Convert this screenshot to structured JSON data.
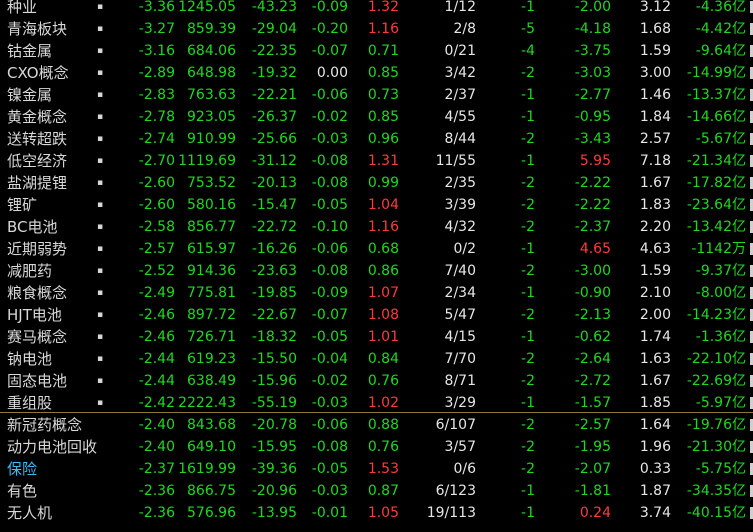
{
  "rows": [
    {
      "name": "种业",
      "v": [
        "-3.36",
        "1245.05",
        "-43.23",
        "-0.09",
        "1.32",
        "1/12",
        "-1",
        "-2.00",
        "3.12",
        "-4.36亿"
      ]
    },
    {
      "name": "青海板块",
      "v": [
        "-3.27",
        "859.39",
        "-29.04",
        "-0.20",
        "1.16",
        "2/8",
        "-5",
        "-4.18",
        "1.68",
        "-4.42亿"
      ]
    },
    {
      "name": "钴金属",
      "v": [
        "-3.16",
        "684.06",
        "-22.35",
        "-0.07",
        "0.71",
        "0/21",
        "-4",
        "-3.75",
        "1.59",
        "-9.64亿"
      ]
    },
    {
      "name": "CXO概念",
      "v": [
        "-2.89",
        "648.98",
        "-19.32",
        "0.00",
        "0.85",
        "3/42",
        "-2",
        "-3.03",
        "3.00",
        "-14.99亿"
      ]
    },
    {
      "name": "镍金属",
      "v": [
        "-2.83",
        "763.63",
        "-22.21",
        "-0.06",
        "0.73",
        "2/37",
        "-1",
        "-2.77",
        "1.46",
        "-13.37亿"
      ]
    },
    {
      "name": "黄金概念",
      "v": [
        "-2.78",
        "923.05",
        "-26.37",
        "-0.02",
        "0.85",
        "4/55",
        "-1",
        "-0.95",
        "1.84",
        "-14.66亿"
      ]
    },
    {
      "name": "送转超跌",
      "v": [
        "-2.74",
        "910.99",
        "-25.66",
        "-0.03",
        "0.96",
        "8/44",
        "-2",
        "-3.43",
        "2.57",
        "-5.67亿"
      ]
    },
    {
      "name": "低空经济",
      "v": [
        "-2.70",
        "1119.69",
        "-31.12",
        "-0.08",
        "1.31",
        "11/55",
        "-1",
        "5.95",
        "7.18",
        "-21.34亿"
      ]
    },
    {
      "name": "盐湖提锂",
      "v": [
        "-2.60",
        "753.52",
        "-20.13",
        "-0.08",
        "0.99",
        "2/35",
        "-2",
        "-2.22",
        "1.67",
        "-17.82亿"
      ]
    },
    {
      "name": "锂矿",
      "v": [
        "-2.60",
        "580.16",
        "-15.47",
        "-0.05",
        "1.04",
        "3/39",
        "-2",
        "-2.22",
        "1.83",
        "-23.64亿"
      ]
    },
    {
      "name": "BC电池",
      "v": [
        "-2.58",
        "856.77",
        "-22.72",
        "-0.10",
        "1.16",
        "4/32",
        "-2",
        "-2.37",
        "2.20",
        "-13.42亿"
      ]
    },
    {
      "name": "近期弱势",
      "v": [
        "-2.57",
        "615.97",
        "-16.26",
        "-0.06",
        "0.68",
        "0/2",
        "-1",
        "4.65",
        "4.63",
        "-1142万"
      ]
    },
    {
      "name": "减肥药",
      "v": [
        "-2.52",
        "914.36",
        "-23.63",
        "-0.08",
        "0.86",
        "7/40",
        "-2",
        "-3.00",
        "1.59",
        "-9.37亿"
      ]
    },
    {
      "name": "粮食概念",
      "v": [
        "-2.49",
        "775.81",
        "-19.85",
        "-0.09",
        "1.07",
        "2/34",
        "-1",
        "-0.90",
        "2.10",
        "-8.00亿"
      ]
    },
    {
      "name": "HJT电池",
      "v": [
        "-2.46",
        "897.72",
        "-22.67",
        "-0.07",
        "1.08",
        "5/47",
        "-2",
        "-2.13",
        "2.00",
        "-14.23亿"
      ]
    },
    {
      "name": "赛马概念",
      "v": [
        "-2.46",
        "726.71",
        "-18.32",
        "-0.05",
        "1.01",
        "4/15",
        "-1",
        "-0.62",
        "1.74",
        "-1.36亿"
      ]
    },
    {
      "name": "钠电池",
      "v": [
        "-2.44",
        "619.23",
        "-15.50",
        "-0.04",
        "0.84",
        "7/70",
        "-2",
        "-2.64",
        "1.63",
        "-22.10亿"
      ]
    },
    {
      "name": "固态电池",
      "v": [
        "-2.44",
        "638.49",
        "-15.96",
        "-0.02",
        "0.76",
        "8/71",
        "-2",
        "-2.72",
        "1.67",
        "-22.69亿"
      ]
    },
    {
      "name": "重组股",
      "v": [
        "-2.42",
        "2222.43",
        "-55.19",
        "-0.03",
        "1.02",
        "3/29",
        "-1",
        "-1.57",
        "1.85",
        "-5.97亿"
      ]
    },
    {
      "name": "新冠药概念",
      "v": [
        "-2.40",
        "843.68",
        "-20.78",
        "-0.06",
        "0.88",
        "6/107",
        "-2",
        "-2.57",
        "1.64",
        "-19.76亿"
      ]
    },
    {
      "name": "动力电池回收",
      "v": [
        "-2.40",
        "649.10",
        "-15.95",
        "-0.08",
        "0.76",
        "3/57",
        "-2",
        "-1.95",
        "1.96",
        "-21.30亿"
      ]
    },
    {
      "name": "保险",
      "v": [
        "-2.37",
        "1619.99",
        "-39.36",
        "-0.05",
        "1.53",
        "0/6",
        "-2",
        "-2.07",
        "0.33",
        "-5.75亿"
      ]
    },
    {
      "name": "有色",
      "v": [
        "-2.36",
        "866.75",
        "-20.96",
        "-0.03",
        "0.87",
        "6/123",
        "-1",
        "-1.81",
        "1.87",
        "-34.35亿"
      ]
    },
    {
      "name": "无人机",
      "v": [
        "-2.36",
        "576.96",
        "-13.95",
        "-0.01",
        "1.05",
        "19/113",
        "-1",
        "0.24",
        "3.74",
        "-40.15亿"
      ]
    }
  ]
}
